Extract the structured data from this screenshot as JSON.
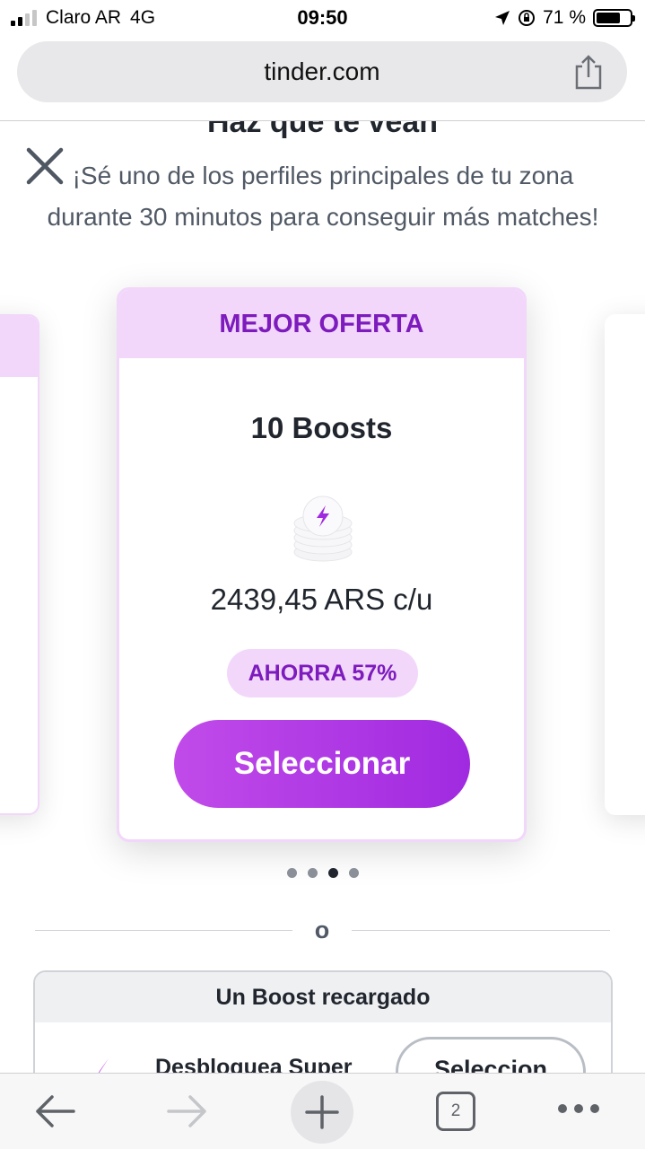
{
  "status_bar": {
    "carrier": "Claro AR",
    "network": "4G",
    "time": "09:50",
    "battery": "71 %",
    "battery_level": 0.71
  },
  "browser": {
    "url": "tinder.com"
  },
  "page": {
    "title": "Haz que te vean",
    "description": "¡Sé uno de los perfiles principales de tu zona durante 30 minutos para conseguir más matches!",
    "offer": {
      "badge": "MEJOR OFERTA",
      "title": "10 Boosts",
      "price": "2439,45 ARS c/u",
      "savings": "AHORRA 57%",
      "button": "Seleccionar"
    },
    "carousel": {
      "count": 4,
      "active_index": 2
    },
    "separator": "o",
    "recharge": {
      "title": "Un Boost recargado",
      "description": "Desbloquea Super",
      "button": "Seleccion"
    }
  },
  "toolbar": {
    "tabs_count": "2"
  },
  "colors": {
    "accent": "#7d1bbd",
    "accent_light": "#f2d7fb",
    "button_gradient_start": "#c14be9",
    "button_gradient_end": "#a02ae0"
  }
}
